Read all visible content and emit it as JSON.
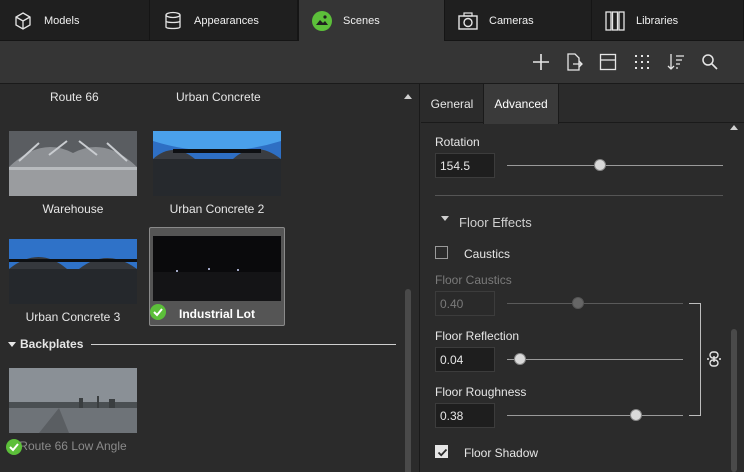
{
  "top_tabs": [
    {
      "label": "Models",
      "icon": "cube-icon"
    },
    {
      "label": "Appearances",
      "icon": "database-icon"
    },
    {
      "label": "Scenes",
      "icon": "scene-image-icon"
    },
    {
      "label": "Cameras",
      "icon": "camera-icon"
    },
    {
      "label": "Libraries",
      "icon": "libraries-icon"
    }
  ],
  "active_tab": "Scenes",
  "toolbar_icons": [
    "add-icon",
    "export-icon",
    "panel-icon",
    "grid-icon",
    "sort-icon",
    "search-icon"
  ],
  "scenes": {
    "top_row_names": [
      "Route 66",
      "Urban Concrete"
    ],
    "items": [
      {
        "name": "Warehouse"
      },
      {
        "name": "Urban Concrete 2"
      },
      {
        "name": "Urban Concrete 3"
      },
      {
        "name": "Industrial Lot",
        "selected": true,
        "applied": true
      }
    ],
    "backplates_header": "Backplates",
    "backplates": [
      {
        "name": "Route 66 Low Angle",
        "applied": true
      }
    ]
  },
  "properties": {
    "tabs": [
      "General",
      "Advanced"
    ],
    "active_tab": "Advanced",
    "rotation_label": "Rotation",
    "rotation_value": "154.5",
    "rotation_level": 0.43,
    "floor_effects_header": "Floor Effects",
    "caustics_label": "Caustics",
    "caustics_checked": false,
    "floor_caustics_label": "Floor Caustics",
    "floor_caustics_value": "0.40",
    "floor_caustics_level": 0.4,
    "floor_reflection_label": "Floor Reflection",
    "floor_reflection_value": "0.04",
    "floor_reflection_level": 0.04,
    "floor_roughness_label": "Floor Roughness",
    "floor_roughness_value": "0.38",
    "floor_roughness_level": 0.73,
    "floor_shadow_label": "Floor Shadow",
    "floor_shadow_checked": true
  },
  "colors": {
    "accent_green": "#5cbf3a",
    "background": "#2b2b2b"
  }
}
